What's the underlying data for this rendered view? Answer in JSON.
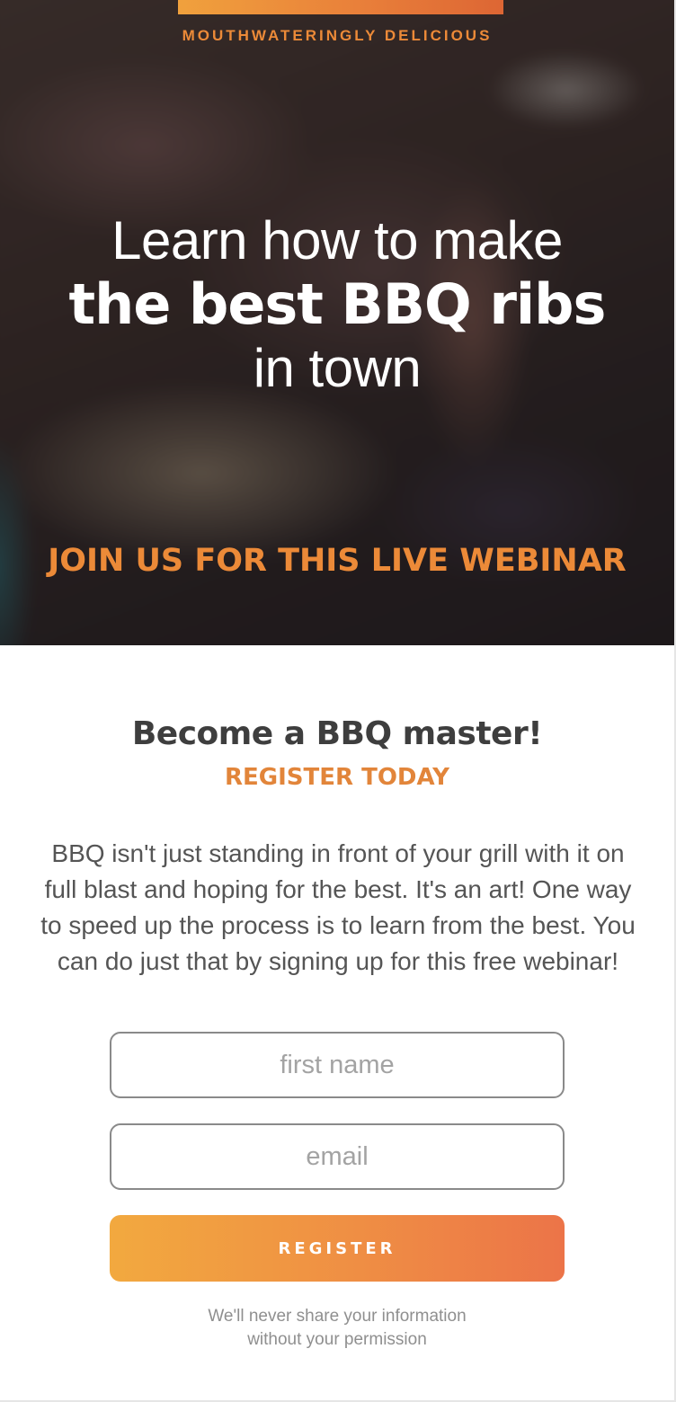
{
  "hero": {
    "eyebrow": "MOUTHWATERINGLY DELICIOUS",
    "title_line1": "Learn how to make",
    "title_line2": "the best BBQ ribs",
    "title_line3": "in town",
    "cta_text": "JOIN US FOR THIS LIVE WEBINAR"
  },
  "section": {
    "heading": "Become a BBQ master!",
    "subheading": "REGISTER TODAY",
    "body": "BBQ isn't just standing in front of your grill with it on full blast and hoping for the best. It's an art! One way to speed up the process is to learn from the best. You can do just that by signing up for this free webinar!"
  },
  "form": {
    "first_name": {
      "placeholder": "first name",
      "value": ""
    },
    "email": {
      "placeholder": "email",
      "value": ""
    },
    "register_label": "REGISTER"
  },
  "privacy": {
    "line1": "We'll never share your information",
    "line2": "without your permission"
  },
  "colors": {
    "accent_orange": "#ec8a38",
    "button_gradient_start": "#f2a93f",
    "button_gradient_end": "#ec7448",
    "heading_text": "#3e3e3e",
    "body_text": "#555555"
  }
}
